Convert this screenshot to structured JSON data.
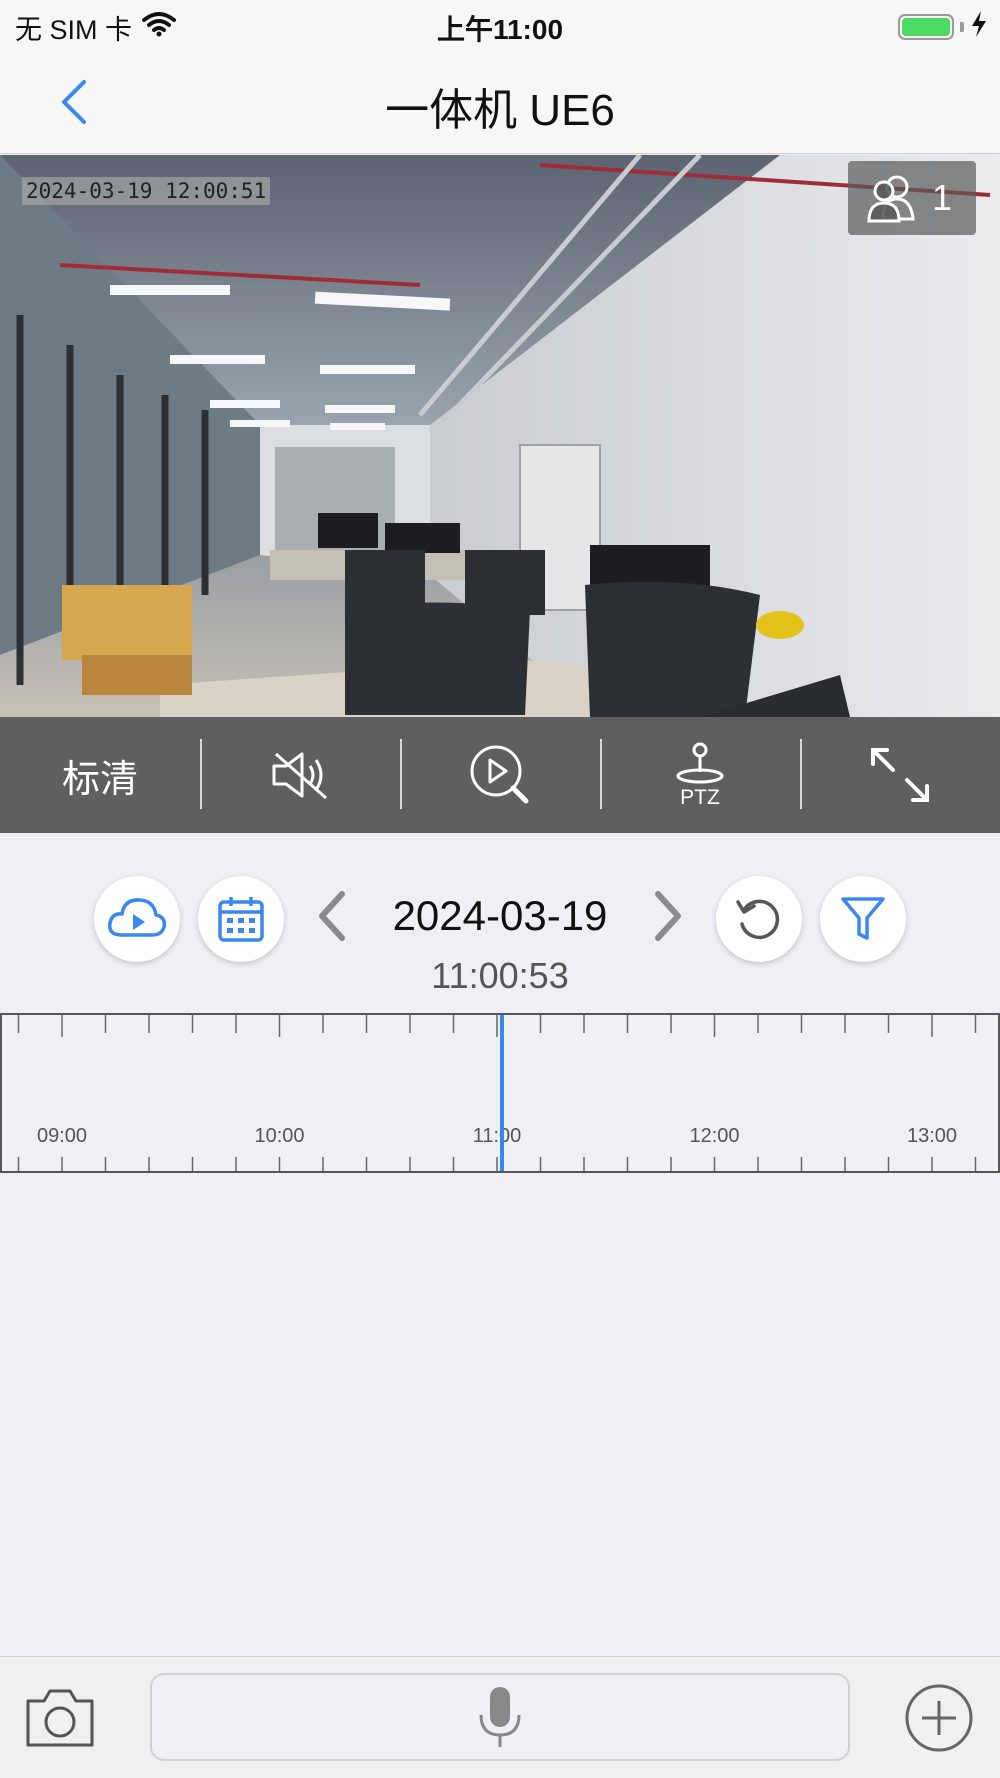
{
  "status_bar": {
    "carrier": "无 SIM 卡",
    "time": "上午11:00",
    "battery_color": "#4cd964"
  },
  "nav": {
    "back_icon": "chevron-left-icon",
    "title": "一体机 UE6",
    "accent_color": "#3a87f0"
  },
  "video": {
    "timestamp": "2024-03-19 12:00:51",
    "viewer_count": "1",
    "viewer_icon": "users-icon"
  },
  "controls": {
    "quality_label": "标清",
    "mute_icon": "speaker-muted-icon",
    "playback_search_icon": "play-search-icon",
    "ptz_label": "PTZ",
    "fullscreen_icon": "expand-icon"
  },
  "playback": {
    "cloud_icon": "cloud-play-icon",
    "calendar_icon": "calendar-icon",
    "date": "2024-03-19",
    "time": "11:00:53",
    "refresh_icon": "refresh-icon",
    "filter_icon": "filter-icon"
  },
  "timeline": {
    "labels": [
      "09:00",
      "10:00",
      "11:00",
      "12:00",
      "13:00"
    ],
    "cursor_color": "#3a87f0"
  },
  "bottom_bar": {
    "camera_icon": "camera-icon",
    "mic_icon": "microphone-icon",
    "add_icon": "plus-circle-icon"
  }
}
